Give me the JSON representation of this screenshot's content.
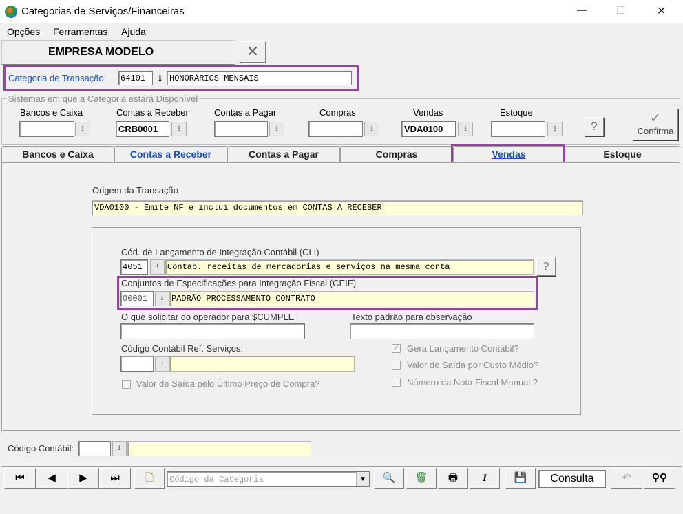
{
  "window": {
    "title": "Categorias de Serviços/Financeiras",
    "minimize": "—",
    "maximize": "☐",
    "close": "✕"
  },
  "menu": {
    "opcoes": "Opções",
    "ferramentas": "Ferramentas",
    "ajuda": "Ajuda"
  },
  "company": "EMPRESA MODELO",
  "transaction": {
    "label": "Categoria de Transação:",
    "code": "64101",
    "description": "HONORÁRIOS MENSAIS"
  },
  "systems": {
    "group_label": "Sistemas em que a Categoria estará Disponível",
    "bancos": {
      "label": "Bancos e Caixa",
      "value": ""
    },
    "receber": {
      "label": "Contas a Receber",
      "value": "CRB0001"
    },
    "pagar": {
      "label": "Contas a Pagar",
      "value": ""
    },
    "compras": {
      "label": "Compras",
      "value": ""
    },
    "vendas": {
      "label": "Vendas",
      "value": "VDA0100"
    },
    "estoque": {
      "label": "Estoque",
      "value": ""
    },
    "confirm_label": "Confirma"
  },
  "tabs": [
    "Bancos e Caixa",
    "Contas a Receber",
    "Contas a Pagar",
    "Compras",
    "Vendas",
    "Estoque"
  ],
  "vendas": {
    "origem_label": "Origem da Transação",
    "origem_value": "VDA0100 - Emite NF e inclui documentos em CONTAS A RECEBER",
    "cli_label": "Cód. de Lançamento de Integração Contábil (CLI)",
    "cli_code": "4051",
    "cli_desc": "Contab. receitas de mercadorias e serviços na mesma conta",
    "ceif_label": "Conjuntos de Especificações para Integração Fiscal (CEIF)",
    "ceif_code": "00001",
    "ceif_desc": "PADRÃO PROCESSAMENTO CONTRATO",
    "solicitar_label": "O que solicitar do operador para $CUMPLE",
    "solicitar_value": "",
    "texto_label": "Texto padrão para observação",
    "texto_value": "",
    "codcont_label": "Código Contábil Ref. Serviços:",
    "codcont_value": "",
    "check_ultimo": "Valor de Saída pelo Último Preço de Compra?",
    "check_gera": "Gera Lançamento Contábil?",
    "check_custo": "Valor de Saída por Custo Médio?",
    "check_nf": "Número da Nota Fiscal Manual ?"
  },
  "codigo_contabil": {
    "label": "Código Contábil:",
    "value": ""
  },
  "toolbar": {
    "search_placeholder": "Código da Categoria",
    "consulta": "Consulta"
  }
}
